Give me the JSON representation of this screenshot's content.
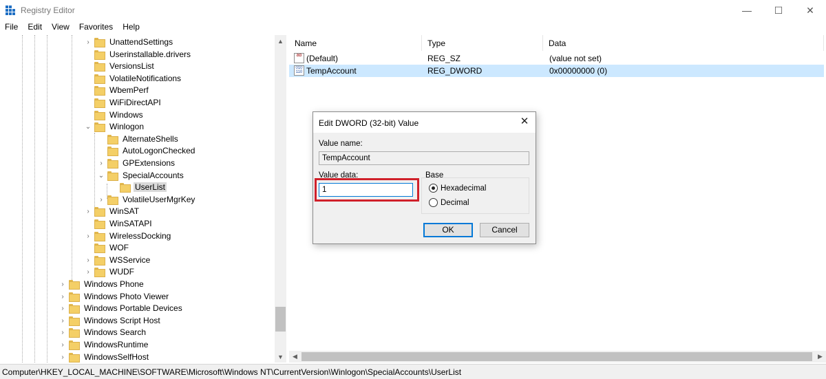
{
  "window": {
    "title": "Registry Editor",
    "minimize_glyph": "—",
    "maximize_glyph": "☐",
    "close_glyph": "✕"
  },
  "menu": [
    "File",
    "Edit",
    "View",
    "Favorites",
    "Help"
  ],
  "tree": {
    "items": [
      {
        "label": "UnattendSettings",
        "expander": "›",
        "level": 3
      },
      {
        "label": "Userinstallable.drivers",
        "expander": "",
        "level": 3
      },
      {
        "label": "VersionsList",
        "expander": "",
        "level": 3
      },
      {
        "label": "VolatileNotifications",
        "expander": "",
        "level": 3
      },
      {
        "label": "WbemPerf",
        "expander": "",
        "level": 3
      },
      {
        "label": "WiFiDirectAPI",
        "expander": "",
        "level": 3
      },
      {
        "label": "Windows",
        "expander": "",
        "level": 3
      },
      {
        "label": "Winlogon",
        "expander": "⌄",
        "level": 3
      },
      {
        "label": "AlternateShells",
        "expander": "",
        "level": 4
      },
      {
        "label": "AutoLogonChecked",
        "expander": "",
        "level": 4
      },
      {
        "label": "GPExtensions",
        "expander": "›",
        "level": 4
      },
      {
        "label": "SpecialAccounts",
        "expander": "⌄",
        "level": 4
      },
      {
        "label": "UserList",
        "expander": "",
        "level": 5,
        "selected": true
      },
      {
        "label": "VolatileUserMgrKey",
        "expander": "›",
        "level": 4
      },
      {
        "label": "WinSAT",
        "expander": "›",
        "level": 3
      },
      {
        "label": "WinSATAPI",
        "expander": "",
        "level": 3
      },
      {
        "label": "WirelessDocking",
        "expander": "›",
        "level": 3
      },
      {
        "label": "WOF",
        "expander": "",
        "level": 3
      },
      {
        "label": "WSService",
        "expander": "›",
        "level": 3
      },
      {
        "label": "WUDF",
        "expander": "›",
        "level": 3
      },
      {
        "label": "Windows Phone",
        "expander": "›",
        "level": 2
      },
      {
        "label": "Windows Photo Viewer",
        "expander": "›",
        "level": 2
      },
      {
        "label": "Windows Portable Devices",
        "expander": "›",
        "level": 2
      },
      {
        "label": "Windows Script Host",
        "expander": "›",
        "level": 2
      },
      {
        "label": "Windows Search",
        "expander": "›",
        "level": 2
      },
      {
        "label": "WindowsRuntime",
        "expander": "›",
        "level": 2
      },
      {
        "label": "WindowsSelfHost",
        "expander": "›",
        "level": 2
      }
    ]
  },
  "list": {
    "columns": [
      "Name",
      "Type",
      "Data"
    ],
    "rows": [
      {
        "icon": "string-value-icon",
        "icon_text": "ab",
        "name": "(Default)",
        "type": "REG_SZ",
        "data": "(value not set)",
        "selected": false
      },
      {
        "icon": "binary-value-icon",
        "icon_text": "010 110",
        "name": "TempAccount",
        "type": "REG_DWORD",
        "data": "0x00000000 (0)",
        "selected": true
      }
    ]
  },
  "status": {
    "path": "Computer\\HKEY_LOCAL_MACHINE\\SOFTWARE\\Microsoft\\Windows NT\\CurrentVersion\\Winlogon\\SpecialAccounts\\UserList"
  },
  "dialog": {
    "title": "Edit DWORD (32-bit) Value",
    "close_glyph": "✕",
    "value_name_label": "Value name:",
    "value_name": "TempAccount",
    "value_data_label": "Value data:",
    "value_data": "1",
    "base_label": "Base",
    "base_options": [
      {
        "label": "Hexadecimal",
        "checked": true
      },
      {
        "label": "Decimal",
        "checked": false
      }
    ],
    "ok_label": "OK",
    "cancel_label": "Cancel",
    "highlight_color": "#d0202a"
  },
  "colors": {
    "selection_light": "#cce8ff",
    "tree_selection": "#d9d9d9",
    "accent": "#0078d7",
    "folder": "#f4cf67"
  }
}
